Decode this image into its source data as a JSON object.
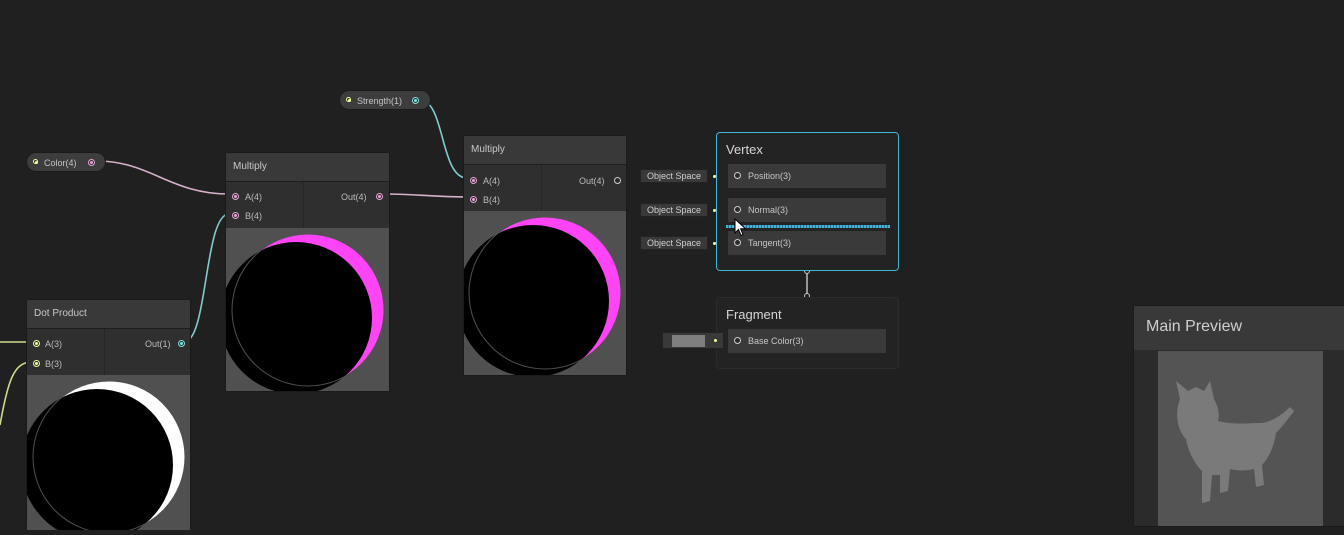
{
  "nodes": {
    "color_prop": {
      "label": "Color(4)"
    },
    "strength_prop": {
      "label": "Strength(1)"
    },
    "dot_product": {
      "title": "Dot Product",
      "input_a": "A(3)",
      "input_b": "B(3)",
      "output": "Out(1)"
    },
    "multiply_1": {
      "title": "Multiply",
      "input_a": "A(4)",
      "input_b": "B(4)",
      "output": "Out(4)"
    },
    "multiply_2": {
      "title": "Multiply",
      "input_a": "A(4)",
      "input_b": "B(4)",
      "output": "Out(4)"
    }
  },
  "master": {
    "vertex": {
      "title": "Vertex",
      "slots": [
        {
          "label": "Position(3)",
          "space": "Object Space"
        },
        {
          "label": "Normal(3)",
          "space": "Object Space"
        },
        {
          "label": "Tangent(3)",
          "space": "Object Space"
        }
      ]
    },
    "fragment": {
      "title": "Fragment",
      "slots": [
        {
          "label": "Base Color(3)",
          "swatch_color": "#7f7f7f"
        }
      ]
    }
  },
  "main_preview": {
    "title": "Main Preview"
  },
  "colors": {
    "vector4_wire": "#d9b0cc",
    "vector1_wire": "#83c9d0",
    "vector3_wire": "#cddb8f",
    "master_border": "#44b3d9",
    "preview_highlight": "#ff44f5"
  }
}
